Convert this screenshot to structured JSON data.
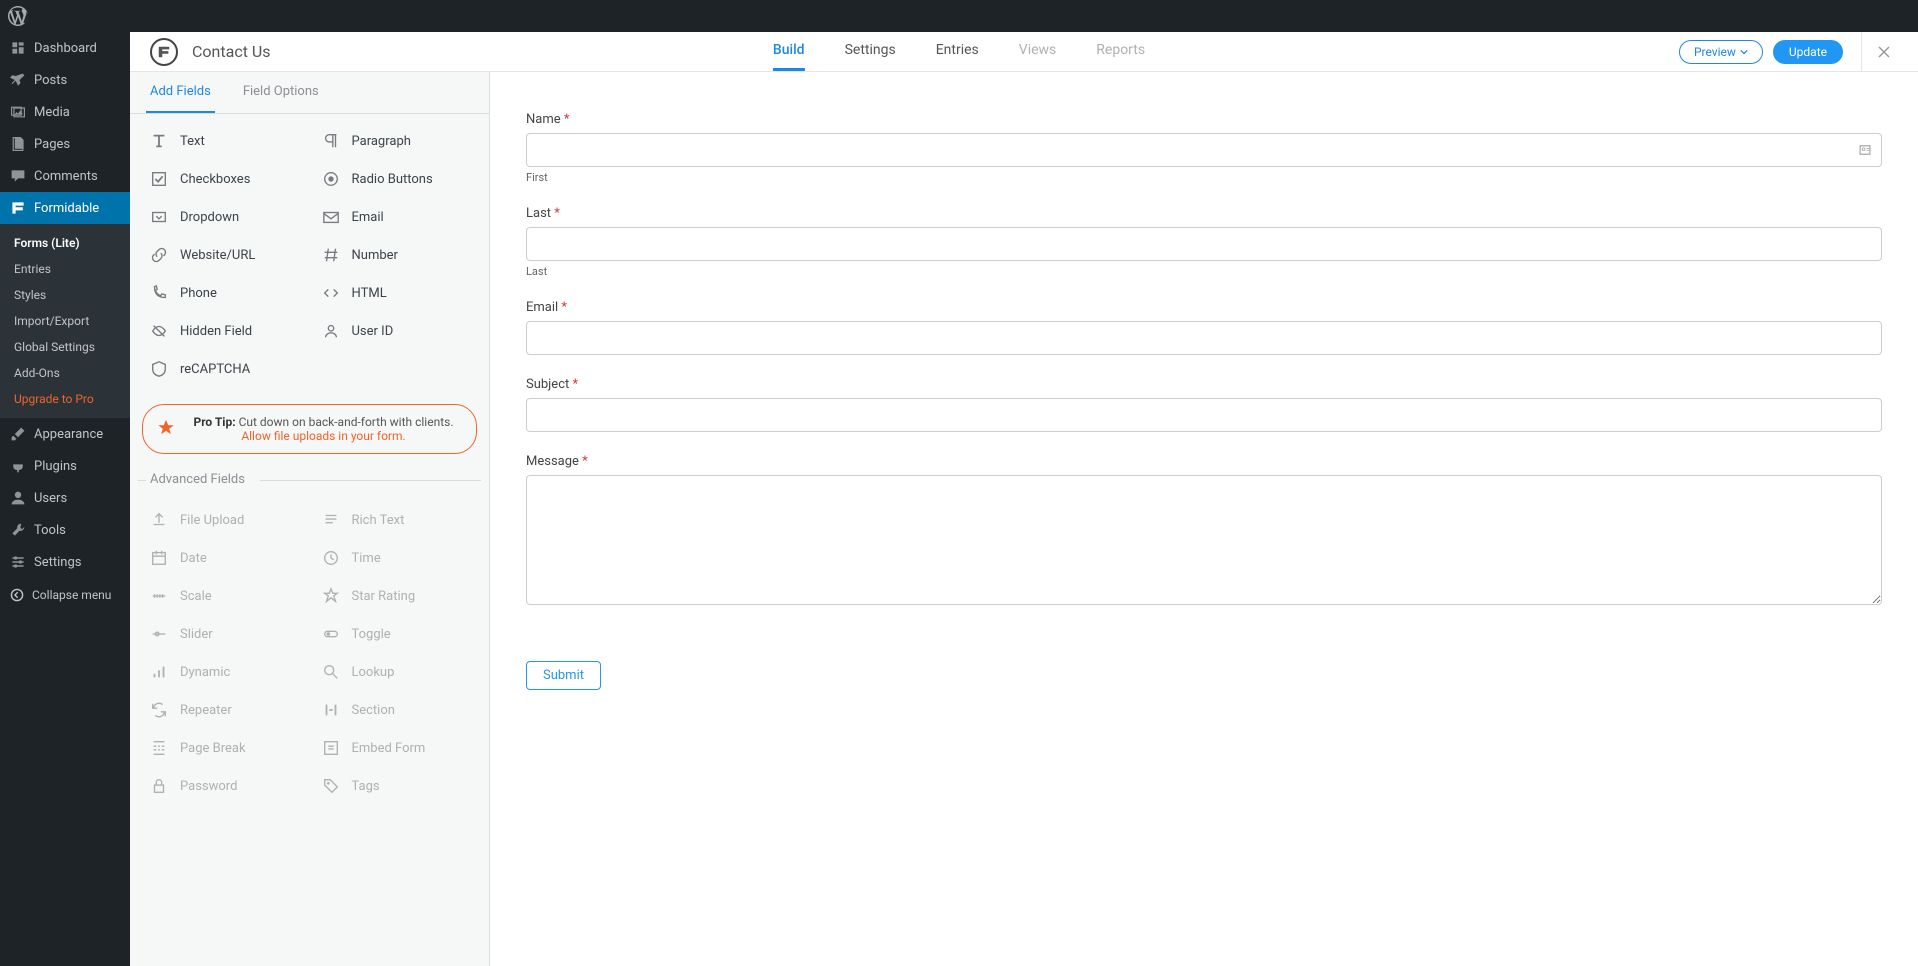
{
  "adminbar": {
    "wp": "WordPress"
  },
  "wp_menu": [
    {
      "id": "dashboard",
      "label": "Dashboard",
      "icon": "dashboard"
    },
    {
      "id": "posts",
      "label": "Posts",
      "icon": "pin"
    },
    {
      "id": "media",
      "label": "Media",
      "icon": "media"
    },
    {
      "id": "pages",
      "label": "Pages",
      "icon": "pages"
    },
    {
      "id": "comments",
      "label": "Comments",
      "icon": "comment"
    },
    {
      "id": "formidable",
      "label": "Formidable",
      "icon": "formidable",
      "active": true
    },
    {
      "id": "appearance",
      "label": "Appearance",
      "icon": "brush"
    },
    {
      "id": "plugins",
      "label": "Plugins",
      "icon": "plugin"
    },
    {
      "id": "users",
      "label": "Users",
      "icon": "user"
    },
    {
      "id": "tools",
      "label": "Tools",
      "icon": "wrench"
    },
    {
      "id": "settings",
      "label": "Settings",
      "icon": "sliders"
    }
  ],
  "formidable_submenu": [
    {
      "label": "Forms (Lite)",
      "current": true
    },
    {
      "label": "Entries"
    },
    {
      "label": "Styles"
    },
    {
      "label": "Import/Export"
    },
    {
      "label": "Global Settings"
    },
    {
      "label": "Add-Ons"
    },
    {
      "label": "Upgrade to Pro",
      "upgrade": true
    }
  ],
  "collapse_label": "Collapse menu",
  "header": {
    "form_title": "Contact Us",
    "tabs": [
      {
        "label": "Build",
        "active": true
      },
      {
        "label": "Settings"
      },
      {
        "label": "Entries"
      },
      {
        "label": "Views",
        "disabled": true
      },
      {
        "label": "Reports",
        "disabled": true
      }
    ],
    "preview_label": "Preview",
    "update_label": "Update"
  },
  "panel": {
    "tabs": [
      {
        "label": "Add Fields",
        "active": true
      },
      {
        "label": "Field Options"
      }
    ],
    "basic_fields": [
      {
        "label": "Text",
        "icon": "text"
      },
      {
        "label": "Paragraph",
        "icon": "paragraph"
      },
      {
        "label": "Checkboxes",
        "icon": "checkbox"
      },
      {
        "label": "Radio Buttons",
        "icon": "radio"
      },
      {
        "label": "Dropdown",
        "icon": "dropdown"
      },
      {
        "label": "Email",
        "icon": "email"
      },
      {
        "label": "Website/URL",
        "icon": "link"
      },
      {
        "label": "Number",
        "icon": "hash"
      },
      {
        "label": "Phone",
        "icon": "phone"
      },
      {
        "label": "HTML",
        "icon": "code"
      },
      {
        "label": "Hidden Field",
        "icon": "hidden"
      },
      {
        "label": "User ID",
        "icon": "userid"
      },
      {
        "label": "reCAPTCHA",
        "icon": "shield"
      }
    ],
    "tip": {
      "prefix": "Pro Tip:",
      "text": " Cut down on back-and-forth with clients. ",
      "link": "Allow file uploads in your form."
    },
    "advanced_header": "Advanced Fields",
    "advanced_fields": [
      {
        "label": "File Upload",
        "icon": "upload"
      },
      {
        "label": "Rich Text",
        "icon": "richtext"
      },
      {
        "label": "Date",
        "icon": "date"
      },
      {
        "label": "Time",
        "icon": "time"
      },
      {
        "label": "Scale",
        "icon": "scale"
      },
      {
        "label": "Star Rating",
        "icon": "star"
      },
      {
        "label": "Slider",
        "icon": "slider"
      },
      {
        "label": "Toggle",
        "icon": "toggle"
      },
      {
        "label": "Dynamic",
        "icon": "dynamic"
      },
      {
        "label": "Lookup",
        "icon": "search"
      },
      {
        "label": "Repeater",
        "icon": "repeat"
      },
      {
        "label": "Section",
        "icon": "section"
      },
      {
        "label": "Page Break",
        "icon": "pagebreak"
      },
      {
        "label": "Embed Form",
        "icon": "embed"
      },
      {
        "label": "Password",
        "icon": "lock"
      },
      {
        "label": "Tags",
        "icon": "tags"
      }
    ]
  },
  "form": {
    "fields": [
      {
        "label": "Name",
        "required": true,
        "desc": "First",
        "type": "text",
        "hasIcon": true
      },
      {
        "label": "Last",
        "required": true,
        "desc": "Last",
        "type": "text"
      },
      {
        "label": "Email",
        "required": true,
        "type": "text"
      },
      {
        "label": "Subject",
        "required": true,
        "type": "text"
      },
      {
        "label": "Message",
        "required": true,
        "type": "textarea"
      }
    ],
    "submit_label": "Submit"
  }
}
